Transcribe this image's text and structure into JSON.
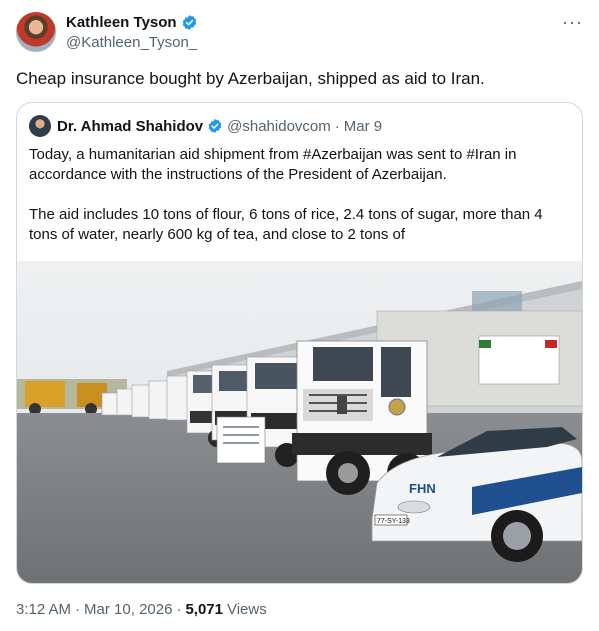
{
  "author": {
    "display_name": "Kathleen Tyson",
    "handle": "@Kathleen_Tyson_",
    "verified": true
  },
  "tweet": {
    "text": "Cheap insurance bought by Azerbaijan, shipped as aid to Iran."
  },
  "more_icon": "more-horizontal-icon",
  "quoted_tweet": {
    "display_name": "Dr. Ahmad Shahidov",
    "handle": "@shahidovcom",
    "separator": "·",
    "date": "Mar 9",
    "verified": true,
    "paragraphs": [
      "Today, a humanitarian aid shipment from #Azerbaijan was sent to #Iran in accordance with the instructions of the President of Azerbaijan.",
      "The aid includes 10 tons of flour, 6 tons of rice, 2.4 tons of sugar, more than 4 tons of water, nearly 600 kg of tea, and close to 2 tons of"
    ],
    "photo": {
      "police_car_text": "FHN",
      "plate_text": "77-SY-133"
    }
  },
  "meta": {
    "time": "3:12 AM",
    "sep1": "·",
    "date": "Mar 10, 2026",
    "sep2": "·",
    "views_count": "5,071",
    "views_label": "Views"
  },
  "colors": {
    "verified_blue": "#1d9bf0",
    "secondary_text": "#536471",
    "border": "#cfd9de"
  }
}
